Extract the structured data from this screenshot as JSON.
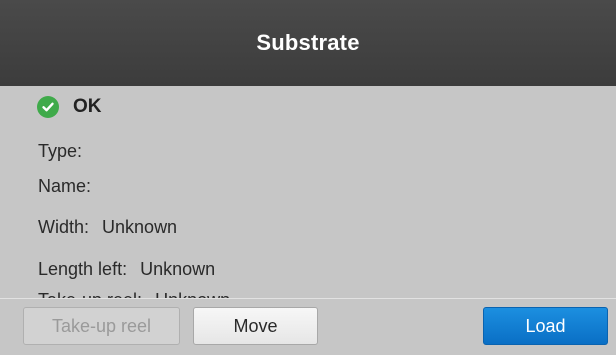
{
  "header": {
    "title": "Substrate"
  },
  "status": {
    "icon": "check-circle-icon",
    "color": "#3faa4a",
    "text": "OK"
  },
  "info": {
    "type_label": "Type:",
    "type_value": "",
    "name_label": "Name:",
    "name_value": "",
    "width_label": "Width:",
    "width_value": "Unknown",
    "length_label": "Length left:",
    "length_value": "Unknown",
    "partial_label": "Take-up reel:",
    "partial_value": "Unknown"
  },
  "footer": {
    "takeup_label": "Take-up reel",
    "move_label": "Move",
    "load_label": "Load",
    "load_color": "#0a6fc5"
  }
}
